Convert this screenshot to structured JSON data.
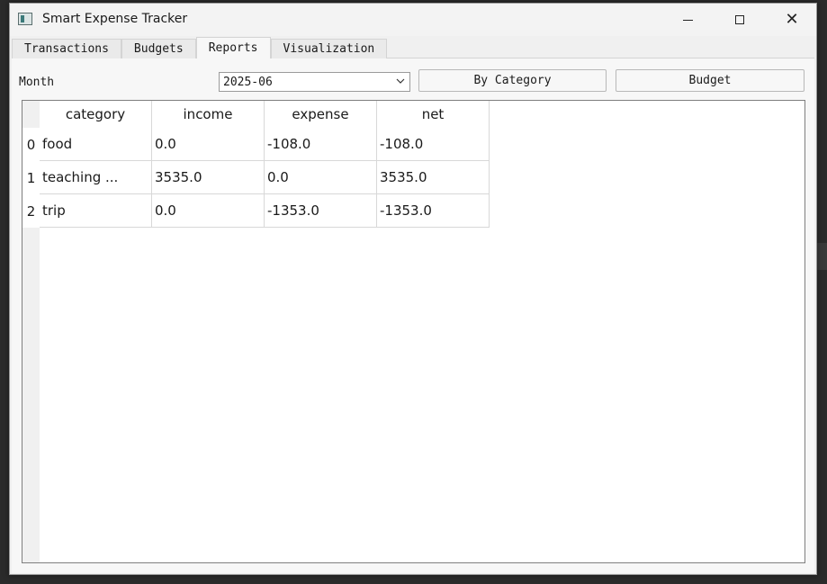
{
  "window": {
    "title": "Smart Expense Tracker"
  },
  "tabs": [
    {
      "label": "Transactions",
      "active": false
    },
    {
      "label": "Budgets",
      "active": false
    },
    {
      "label": "Reports",
      "active": true
    },
    {
      "label": "Visualization",
      "active": false
    }
  ],
  "controls": {
    "month_label": "Month",
    "month_value": "2025-06",
    "by_category_label": "By Category",
    "budget_label": "Budget"
  },
  "table": {
    "columns": [
      "category",
      "income",
      "expense",
      "net"
    ],
    "rows": [
      {
        "index": "0",
        "category": "food",
        "income": "0.0",
        "expense": "-108.0",
        "net": "-108.0"
      },
      {
        "index": "1",
        "category": "teaching ...",
        "income": "3535.0",
        "expense": "0.0",
        "net": "3535.0"
      },
      {
        "index": "2",
        "category": "trip",
        "income": "0.0",
        "expense": "-1353.0",
        "net": "-1353.0"
      }
    ]
  },
  "icons": {
    "app": "app-window-icon",
    "minimize": "minimize-icon",
    "maximize": "maximize-icon",
    "close": "close-icon",
    "dropdown": "chevron-down-icon"
  }
}
